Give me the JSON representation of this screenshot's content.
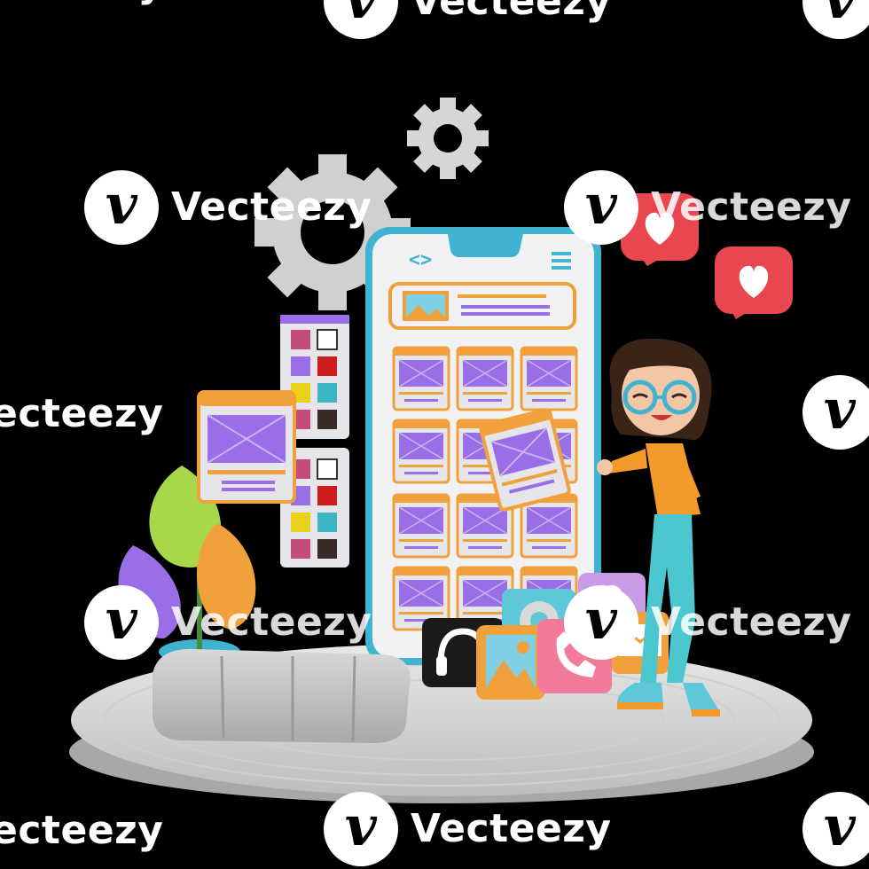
{
  "watermark": {
    "brand": "Vecteezy",
    "partial_left": "ecteezy",
    "logo_glyph": "v"
  },
  "phone": {
    "code_icon": "code-brackets-icon",
    "menu_icon": "hamburger-menu-icon"
  },
  "colors": {
    "background": "#000000",
    "phone_frame": "#3fb3d1",
    "card_orange": "#f0a13b",
    "card_purple": "#9a6ee6",
    "heart_red": "#e8474f",
    "floor": "#d9d9d9",
    "jacket": "#f39a2a",
    "pants": "#4cc6cf"
  },
  "icons": [
    "heart-icon",
    "gear-icon",
    "headphones-icon",
    "image-icon",
    "phone-icon",
    "settings-icon",
    "user-icon",
    "mail-icon"
  ]
}
